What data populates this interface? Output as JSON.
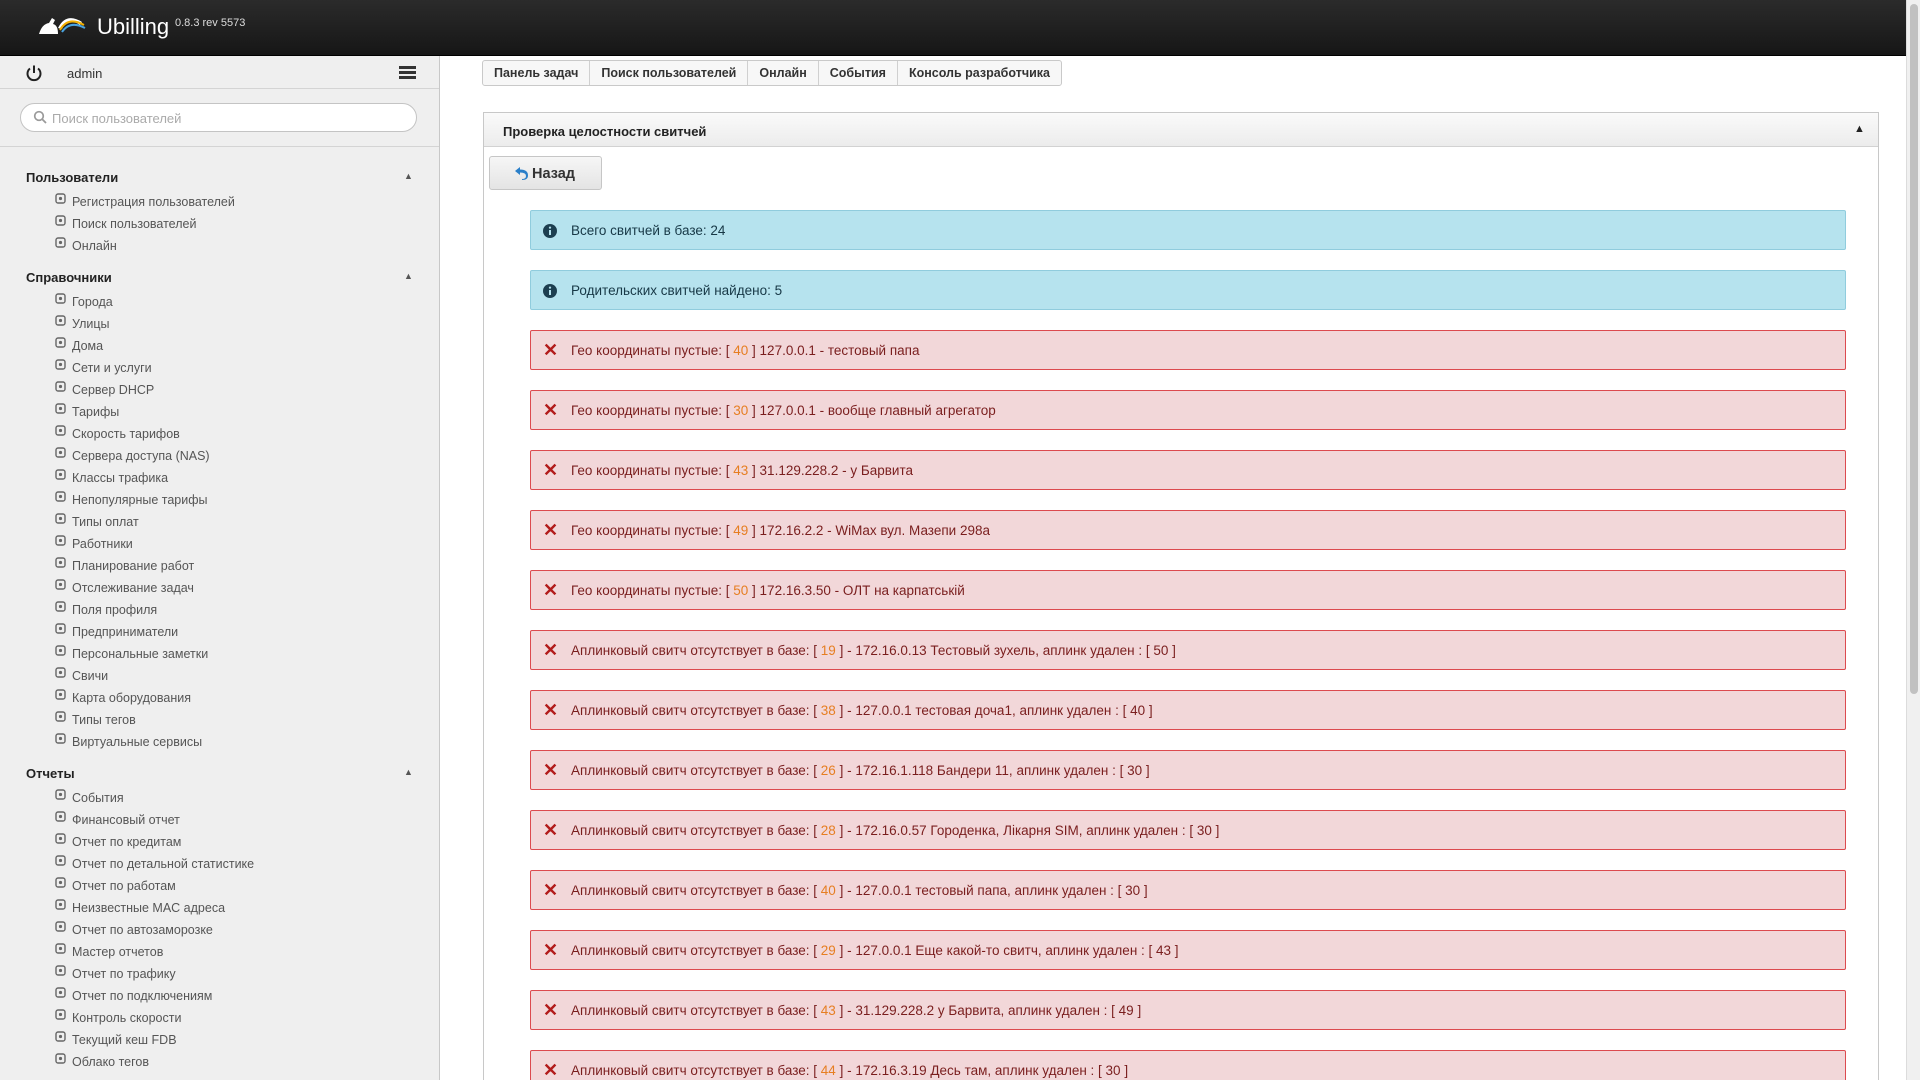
{
  "app": {
    "name": "Ubilling",
    "version": "0.8.3 rev 5573"
  },
  "user": {
    "name": "admin"
  },
  "search": {
    "placeholder": "Поиск пользователей"
  },
  "sidebar": {
    "sections": [
      {
        "title": "Пользователи",
        "items": [
          {
            "label": "Регистрация пользователей",
            "icon": "user-add-icon"
          },
          {
            "label": "Поиск пользователей",
            "icon": "magnifier-icon"
          },
          {
            "label": "Онлайн",
            "icon": "users-online-icon"
          }
        ]
      },
      {
        "title": "Справочники",
        "items": [
          {
            "label": "Города",
            "icon": "city-icon"
          },
          {
            "label": "Улицы",
            "icon": "street-icon"
          },
          {
            "label": "Дома",
            "icon": "house-icon"
          },
          {
            "label": "Сети и услуги",
            "icon": "network-icon"
          },
          {
            "label": "Сервер DHCP",
            "icon": "server-icon"
          },
          {
            "label": "Тарифы",
            "icon": "dollar-icon"
          },
          {
            "label": "Скорость тарифов",
            "icon": "speed-icon"
          },
          {
            "label": "Сервера доступа (NAS)",
            "icon": "nas-icon"
          },
          {
            "label": "Классы трафика",
            "icon": "traffic-class-icon"
          },
          {
            "label": "Непопулярные тарифы",
            "icon": "unpopular-tariff-icon"
          },
          {
            "label": "Типы оплат",
            "icon": "payment-type-icon"
          },
          {
            "label": "Работники",
            "icon": "worker-icon"
          },
          {
            "label": "Планирование работ",
            "icon": "planning-icon"
          },
          {
            "label": "Отслеживание задач",
            "icon": "task-tracking-icon"
          },
          {
            "label": "Поля профиля",
            "icon": "profile-fields-icon"
          },
          {
            "label": "Предприниматели",
            "icon": "entrepreneur-icon"
          },
          {
            "label": "Персональные заметки",
            "icon": "pin-icon"
          },
          {
            "label": "Свичи",
            "icon": "switch-icon"
          },
          {
            "label": "Карта оборудования",
            "icon": "map-icon"
          },
          {
            "label": "Типы тегов",
            "icon": "tag-icon"
          },
          {
            "label": "Виртуальные сервисы",
            "icon": "virtual-service-icon"
          }
        ]
      },
      {
        "title": "Отчеты",
        "items": [
          {
            "label": "События",
            "icon": "events-icon"
          },
          {
            "label": "Финансовый отчет",
            "icon": "finance-icon"
          },
          {
            "label": "Отчет по кредитам",
            "icon": "credit-icon"
          },
          {
            "label": "Отчет по детальной статистике",
            "icon": "sigma-icon"
          },
          {
            "label": "Отчет по работам",
            "icon": "works-icon"
          },
          {
            "label": "Неизвестные MAC адреса",
            "icon": "mac-icon"
          },
          {
            "label": "Отчет по автозаморозке",
            "icon": "snowflake-icon"
          },
          {
            "label": "Мастер отчетов",
            "icon": "report-master-icon"
          },
          {
            "label": "Отчет по трафику",
            "icon": "traffic-icon"
          },
          {
            "label": "Отчет по подключениям",
            "icon": "connections-icon"
          },
          {
            "label": "Контроль скорости",
            "icon": "speed-control-icon"
          },
          {
            "label": "Текущий кеш FDB",
            "icon": "fdb-icon"
          },
          {
            "label": "Облако тегов",
            "icon": "tag-cloud-icon"
          }
        ]
      }
    ]
  },
  "breadcrumb": [
    "Панель задач",
    "Поиск пользователей",
    "Онлайн",
    "События",
    "Консоль разработчика"
  ],
  "panel": {
    "title": "Проверка целостности свитчей",
    "toggle": "▲",
    "back_label": "Назад"
  },
  "alerts": [
    {
      "type": "info",
      "text": "Всего свитчей в базе: 24"
    },
    {
      "type": "info",
      "text": "Родительских свитчей найдено: 5"
    },
    {
      "type": "error",
      "prefix": "Гео координаты пустые: [",
      "num": "40",
      "suffix": "] 127.0.0.1 - тестовый папа"
    },
    {
      "type": "error",
      "prefix": "Гео координаты пустые: [",
      "num": "30",
      "suffix": "] 127.0.0.1 - вообще главный агрегатор"
    },
    {
      "type": "error",
      "prefix": "Гео координаты пустые: [",
      "num": "43",
      "suffix": "] 31.129.228.2 - у Барвита"
    },
    {
      "type": "error",
      "prefix": "Гео координаты пустые: [",
      "num": "49",
      "suffix": "] 172.16.2.2 - WiMax вул. Мазепи 298а"
    },
    {
      "type": "error",
      "prefix": "Гео координаты пустые: [",
      "num": "50",
      "suffix": "] 172.16.3.50 - ОЛТ на карпатській"
    },
    {
      "type": "error",
      "prefix": "Аплинковый свитч отсутствует в базе: [",
      "num": "19",
      "suffix": "] - 172.16.0.13 Тестовый зухель, аплинк удален : [ 50 ]"
    },
    {
      "type": "error",
      "prefix": "Аплинковый свитч отсутствует в базе: [",
      "num": "38",
      "suffix": "] - 127.0.0.1 тестовая доча1, аплинк удален : [ 40 ]"
    },
    {
      "type": "error",
      "prefix": "Аплинковый свитч отсутствует в базе: [",
      "num": "26",
      "suffix": "] - 172.16.1.118 Бандери 11, аплинк удален : [ 30 ]"
    },
    {
      "type": "error",
      "prefix": "Аплинковый свитч отсутствует в базе: [",
      "num": "28",
      "suffix": "] - 172.16.0.57 Городенка, Лікарня SIM, аплинк удален : [ 30 ]"
    },
    {
      "type": "error",
      "prefix": "Аплинковый свитч отсутствует в базе: [",
      "num": "40",
      "suffix": "] - 127.0.0.1 тестовый папа, аплинк удален : [ 30 ]"
    },
    {
      "type": "error",
      "prefix": "Аплинковый свитч отсутствует в базе: [",
      "num": "29",
      "suffix": "] - 127.0.0.1 Еще какой-то свитч, аплинк удален : [ 43 ]"
    },
    {
      "type": "error",
      "prefix": "Аплинковый свитч отсутствует в базе: [",
      "num": "43",
      "suffix": "] - 31.129.228.2 у Барвита, аплинк удален : [ 49 ]"
    },
    {
      "type": "error",
      "prefix": "Аплинковый свитч отсутствует в базе: [",
      "num": "44",
      "suffix": "] - 172.16.3.19 Десь там, аплинк удален : [ 30 ]"
    }
  ],
  "colors": {
    "info_bg": "#b6e3ee",
    "error_bg": "#f2d7d9",
    "error_border": "#dc4a4f",
    "accent_num": "#e67e22",
    "topbar": "#1e1e1e"
  }
}
